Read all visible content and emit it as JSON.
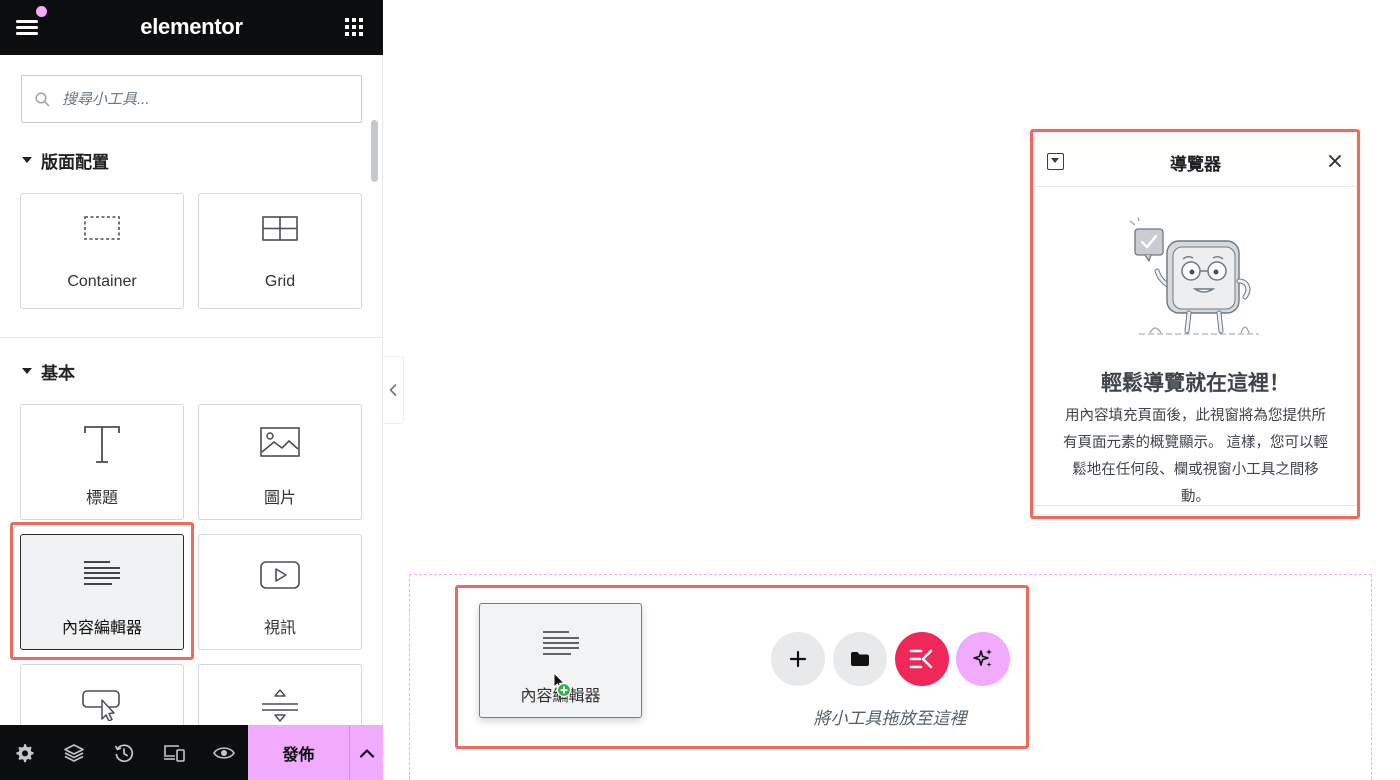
{
  "app": {
    "brand": "elementor"
  },
  "search": {
    "placeholder": "搜尋小工具..."
  },
  "sections": [
    {
      "title": "版面配置"
    },
    {
      "title": "基本"
    }
  ],
  "widgets": {
    "container": "Container",
    "grid": "Grid",
    "heading": "標題",
    "image": "圖片",
    "text_editor": "內容編輯器",
    "video": "視訊"
  },
  "bottombar": {
    "publish_label": "發佈"
  },
  "navigator": {
    "title": "導覽器",
    "heading": "輕鬆導覽就在這裡！",
    "text": "用內容填充頁面後，此視窗將為您提供所有頁面元素的概覽顯示。 這樣，您可以輕鬆地在任何段、欄或視窗小工具之間移動。"
  },
  "canvas": {
    "dragged_widget_label": "內容編輯器",
    "drop_hint": "將小工具拖放至這裡"
  },
  "colors": {
    "accent_pink": "#f0abfc",
    "elementor_red": "#f0285a",
    "highlight": "#ef6a5e",
    "dark": "#0c0d0e"
  }
}
